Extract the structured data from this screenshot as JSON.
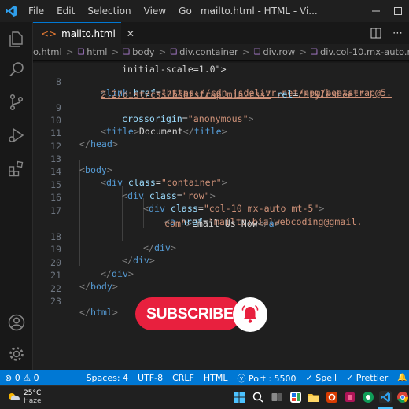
{
  "titlebar": {
    "menu": [
      "File",
      "Edit",
      "Selection",
      "View",
      "Go"
    ],
    "more": "···",
    "title": "mailto.html - HTML - Vi..."
  },
  "tabs": [
    {
      "label": "mailto.html",
      "close": "✕"
    }
  ],
  "breadcrumb": [
    {
      "label": "o.html"
    },
    {
      "label": "html"
    },
    {
      "label": "body"
    },
    {
      "label": "div.container"
    },
    {
      "label": "div.row"
    },
    {
      "label": "div.col-10.mx-auto.mt-5"
    }
  ],
  "editor": {
    "top_fragment": "initial-scale=1.0\">",
    "lines": {
      "l8": "8",
      "l9": "9",
      "l10": "10",
      "l11": "11",
      "l12": "12",
      "l13": "13",
      "l14": "14",
      "l15": "15",
      "l16": "16",
      "l17": "17",
      "l18": "18",
      "l19": "19",
      "l20": "20",
      "l21": "21",
      "l22": "22",
      "l23": "23"
    },
    "code": {
      "link_tag": "link",
      "href_attr": "href",
      "href_val_1": "\"https://cdn.jsdelivr.net/npm/bootstrap@5.",
      "href_val_2": "2.2/dist/css/bootstrap.min.css\"",
      "rel_attr": "rel",
      "rel_val": "\"stylesheet\"",
      "crossorigin_attr": "crossorigin",
      "crossorigin_val": "\"anonymous\"",
      "title_tag": "title",
      "title_text": "Document",
      "head_tag": "head",
      "body_tag": "body",
      "div_tag": "div",
      "class_attr": "class",
      "container_val": "\"container\"",
      "row_val": "\"row\"",
      "col_val": "\"col-10 mx-auto mt-5\"",
      "a_tag": "a",
      "mailto_val_1": "\"mailto:bialwebcoding@gmail.",
      "mailto_val_2": "com\"",
      "link_text": "Email Us Now",
      "html_tag": "html"
    }
  },
  "subscribe": {
    "label": "SUBSCRIBE"
  },
  "statusbar": {
    "errors": "⊗ 0 ⚠ 0",
    "spaces": "Spaces: 4",
    "encoding": "UTF-8",
    "eol": "CRLF",
    "language": "HTML",
    "port": "ⓥ Port : 5500",
    "spell": "✓ Spell",
    "prettier": "✓ Prettier",
    "bell": "🔔"
  },
  "taskbar": {
    "temp": "25°C",
    "condition": "Haze"
  },
  "colors": {
    "accent": "#0078d4",
    "subscribe": "#e8203e",
    "tag": "#569cd6",
    "attr": "#9cdcfe",
    "string": "#ce9178"
  }
}
